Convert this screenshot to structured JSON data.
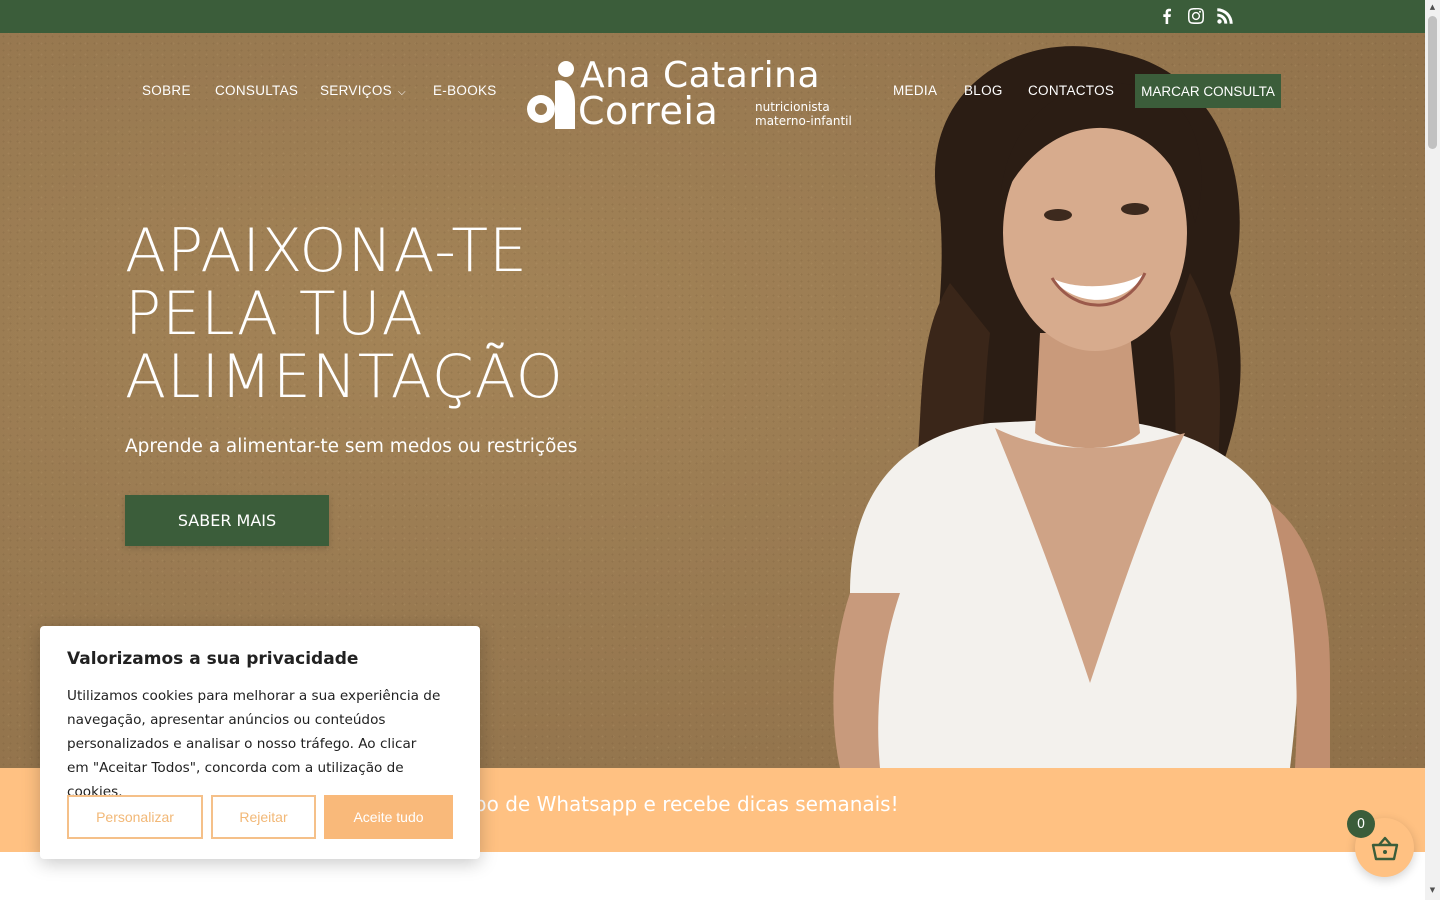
{
  "topbar": {
    "social": [
      {
        "name": "facebook-icon"
      },
      {
        "name": "instagram-icon"
      },
      {
        "name": "rss-icon"
      }
    ]
  },
  "nav": {
    "left": [
      "SOBRE",
      "CONSULTAS",
      "SERVIÇOS",
      "E-BOOKS"
    ],
    "right": [
      "MEDIA",
      "BLOG",
      "CONTACTOS"
    ],
    "cta": "MARCAR CONSULTA",
    "dropdown_icon": "chevron-down-icon"
  },
  "logo": {
    "line1": "Ana Catarina",
    "line2": "Correia",
    "sub1": "nutricionista",
    "sub2": "materno-infantil"
  },
  "hero": {
    "title_lines": [
      "APAIXONA-TE",
      "PELA TUA",
      "ALIMENTAÇÃO"
    ],
    "subtitle": "Aprende a alimentar-te sem medos ou restrições",
    "button": "SABER MAIS"
  },
  "banner": {
    "text": "e ao meu grupo de Whatsapp e recebe dicas semanais!"
  },
  "cookie": {
    "title": "Valorizamos a sua privacidade",
    "text": "Utilizamos cookies para melhorar a sua experiência de navegação, apresentar anúncios ou conteúdos personalizados e analisar o nosso tráfego. Ao clicar em \"Aceitar Todos\", concorda com a utilização de cookies.",
    "customize": "Personalizar",
    "reject": "Rejeitar",
    "accept": "Aceite tudo"
  },
  "cart": {
    "count": "0",
    "icon": "basket-icon"
  },
  "colors": {
    "green": "#3b5d3a",
    "hero_bg": "#9a7b52",
    "peach": "#ffc182",
    "accent_text": "#f2b877"
  }
}
